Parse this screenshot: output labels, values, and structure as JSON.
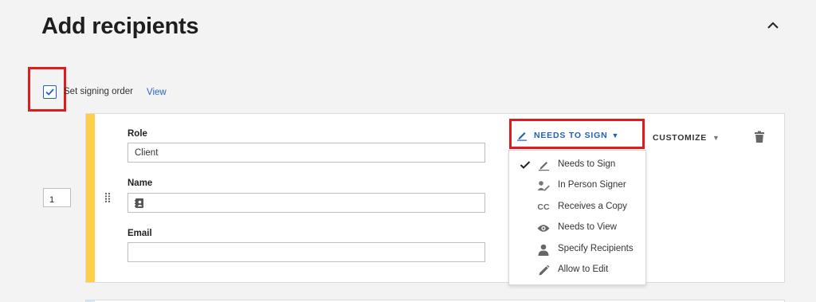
{
  "page": {
    "title": "Add recipients"
  },
  "signing_order": {
    "label": "Set signing order",
    "checked": true,
    "view_link": "View"
  },
  "recipient": {
    "order": "1",
    "role_label": "Role",
    "role_value": "Client",
    "name_label": "Name",
    "name_value": "",
    "email_label": "Email",
    "email_value": "",
    "action_label": "NEEDS TO SIGN",
    "customize_label": "CUSTOMIZE",
    "accent_color": "#ffcf4a"
  },
  "action_menu": {
    "selected": "Needs to Sign",
    "items": [
      {
        "label": "Needs to Sign",
        "icon": "pen-icon"
      },
      {
        "label": "In Person Signer",
        "icon": "in-person-signer-icon"
      },
      {
        "label": "Receives a Copy",
        "icon": "cc-icon",
        "icon_text": "CC"
      },
      {
        "label": "Needs to View",
        "icon": "eye-icon"
      },
      {
        "label": "Specify Recipients",
        "icon": "person-icon"
      },
      {
        "label": "Allow to Edit",
        "icon": "pencil-icon"
      }
    ]
  },
  "colors": {
    "highlight": "#e01b1b",
    "link": "#2a63c7",
    "primary": "#1f5fbf"
  }
}
